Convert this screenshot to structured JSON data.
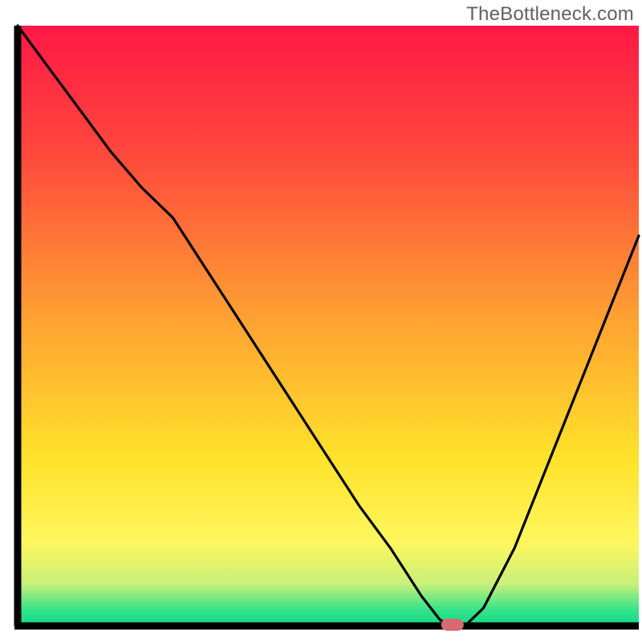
{
  "watermark": "TheBottleneck.com",
  "chart_data": {
    "type": "line",
    "title": "",
    "xlabel": "",
    "ylabel": "",
    "xlim": [
      0,
      100
    ],
    "ylim": [
      0,
      100
    ],
    "x": [
      0,
      5,
      10,
      15,
      20,
      25,
      30,
      35,
      40,
      45,
      50,
      55,
      60,
      65,
      68,
      70,
      72,
      75,
      80,
      85,
      90,
      95,
      100
    ],
    "values": [
      100,
      93,
      86,
      79,
      73,
      68,
      60,
      52,
      44,
      36,
      28,
      20,
      13,
      5,
      1,
      0,
      0,
      3,
      13,
      26,
      39,
      52,
      65
    ],
    "marker": {
      "x": 70,
      "y": 0
    },
    "gradient_stops": [
      {
        "offset": 0.0,
        "color": "#ff1846"
      },
      {
        "offset": 0.22,
        "color": "#ff4a3c"
      },
      {
        "offset": 0.5,
        "color": "#ffa531"
      },
      {
        "offset": 0.72,
        "color": "#ffe22a"
      },
      {
        "offset": 0.86,
        "color": "#fff65e"
      },
      {
        "offset": 0.93,
        "color": "#c9f07a"
      },
      {
        "offset": 0.975,
        "color": "#2fe38a"
      },
      {
        "offset": 1.0,
        "color": "#17d884"
      }
    ],
    "axis_color": "#000000",
    "line_color": "#000000",
    "marker_color": "#d86a6f"
  }
}
